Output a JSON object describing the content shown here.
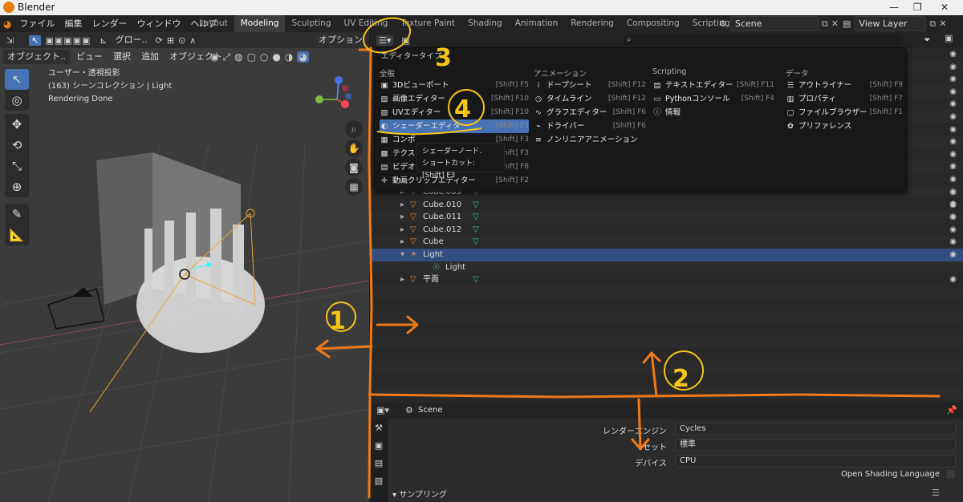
{
  "window": {
    "title": "Blender"
  },
  "menubar": {
    "menus": [
      "ファイル",
      "編集",
      "レンダー",
      "ウィンドウ",
      "ヘルプ"
    ],
    "tabs": [
      "Layout",
      "Modeling",
      "Sculpting",
      "UV Editing",
      "Texture Paint",
      "Shading",
      "Animation",
      "Rendering",
      "Compositing",
      "Scripting"
    ],
    "active_tab": "Modeling",
    "scene": "Scene",
    "view_layer": "View Layer"
  },
  "viewport": {
    "toolbar": {
      "global_label": "グロー..",
      "options_label": "オプション"
    },
    "header": {
      "mode": "オブジェクト..",
      "menus": [
        "ビュー",
        "選択",
        "追加",
        "オブジェクト"
      ]
    },
    "overlay_text": [
      "ユーザー・透視投影",
      "(163) シーンコレクション | Light",
      "Rendering Done"
    ]
  },
  "editor_menu": {
    "title": "エディタータイプ",
    "columns": [
      {
        "head": "全般",
        "items": [
          {
            "icon": "3d-viewport-icon",
            "glyph": "▣",
            "label": "3Dビューポート",
            "shortcut": "[Shift] F5"
          },
          {
            "icon": "image-editor-icon",
            "glyph": "▨",
            "label": "画像エディター",
            "shortcut": "[Shift] F10"
          },
          {
            "icon": "uv-editor-icon",
            "glyph": "▧",
            "label": "UVエディター",
            "shortcut": "[Shift] F10"
          },
          {
            "icon": "shader-editor-icon",
            "glyph": "◐",
            "label": "シェーダーエディター",
            "shortcut": "[Shift] F3"
          },
          {
            "icon": "compositor-icon",
            "glyph": "▦",
            "label": "コンポ",
            "shortcut": "[Shift] F3"
          },
          {
            "icon": "texture-node-icon",
            "glyph": "▩",
            "label": "テクス",
            "shortcut": "[Shift] F3"
          },
          {
            "icon": "video-sequencer-icon",
            "glyph": "▤",
            "label": "ビデオ",
            "shortcut": "[Shift] F8"
          },
          {
            "icon": "movie-clip-icon",
            "glyph": "✛",
            "label": "動画クリップエディター",
            "shortcut": "[Shift] F2"
          }
        ]
      },
      {
        "head": "アニメーション",
        "items": [
          {
            "icon": "dopesheet-icon",
            "glyph": "⁞",
            "label": "ドープシート",
            "shortcut": "[Shift] F12"
          },
          {
            "icon": "timeline-icon",
            "glyph": "◷",
            "label": "タイムライン",
            "shortcut": "[Shift] F12"
          },
          {
            "icon": "graph-editor-icon",
            "glyph": "∿",
            "label": "グラフエディター",
            "shortcut": "[Shift] F6"
          },
          {
            "icon": "drivers-icon",
            "glyph": "⌁",
            "label": "ドライバー",
            "shortcut": "[Shift] F6"
          },
          {
            "icon": "nla-icon",
            "glyph": "≡",
            "label": "ノンリニアアニメーション",
            "shortcut": ""
          }
        ]
      },
      {
        "head": "Scripting",
        "items": [
          {
            "icon": "text-editor-icon",
            "glyph": "▤",
            "label": "テキストエディター",
            "shortcut": "[Shift] F11"
          },
          {
            "icon": "python-console-icon",
            "glyph": "▭",
            "label": "Pythonコンソール",
            "shortcut": "[Shift] F4"
          },
          {
            "icon": "info-icon",
            "glyph": "ⓘ",
            "label": "情報",
            "shortcut": ""
          }
        ]
      },
      {
        "head": "データ",
        "items": [
          {
            "icon": "outliner-icon",
            "glyph": "☰",
            "label": "アウトライナー",
            "shortcut": "[Shift] F9"
          },
          {
            "icon": "properties-icon",
            "glyph": "▥",
            "label": "プロパティ",
            "shortcut": "[Shift] F7"
          },
          {
            "icon": "file-browser-icon",
            "glyph": "▢",
            "label": "ファイルブラウザー",
            "shortcut": "[Shift] F1"
          },
          {
            "icon": "preferences-icon",
            "glyph": "✿",
            "label": "プリファレンス",
            "shortcut": ""
          }
        ]
      }
    ],
    "tooltip": {
      "line1": "シェーダーノード.",
      "line2": "ショートカット: [Shift] F3"
    }
  },
  "outliner": {
    "rows": [
      {
        "label": "Cube.009",
        "kind": "mesh",
        "indent": 1
      },
      {
        "label": "Cube.010",
        "kind": "mesh",
        "indent": 1
      },
      {
        "label": "Cube.011",
        "kind": "mesh",
        "indent": 1
      },
      {
        "label": "Cube.012",
        "kind": "mesh",
        "indent": 1
      },
      {
        "label": "Cube",
        "kind": "mesh",
        "indent": 1
      },
      {
        "label": "Light",
        "kind": "light",
        "indent": 1,
        "selected": true
      },
      {
        "label": "Light",
        "kind": "light-data",
        "indent": 2
      },
      {
        "label": "平面",
        "kind": "mesh",
        "indent": 1
      }
    ]
  },
  "properties": {
    "context": "Scene",
    "fields": [
      {
        "label": "レンダーエンジン",
        "value": "Cycles"
      },
      {
        "label": "セット",
        "value": "標準"
      },
      {
        "label": "デバイス",
        "value": "CPU"
      }
    ],
    "osl_label": "Open Shading Language",
    "section": "サンプリング"
  },
  "annotations": {
    "labels": [
      "1",
      "2",
      "3",
      "4"
    ],
    "color": "#f07a1a",
    "circle_color": "#f5c518"
  }
}
